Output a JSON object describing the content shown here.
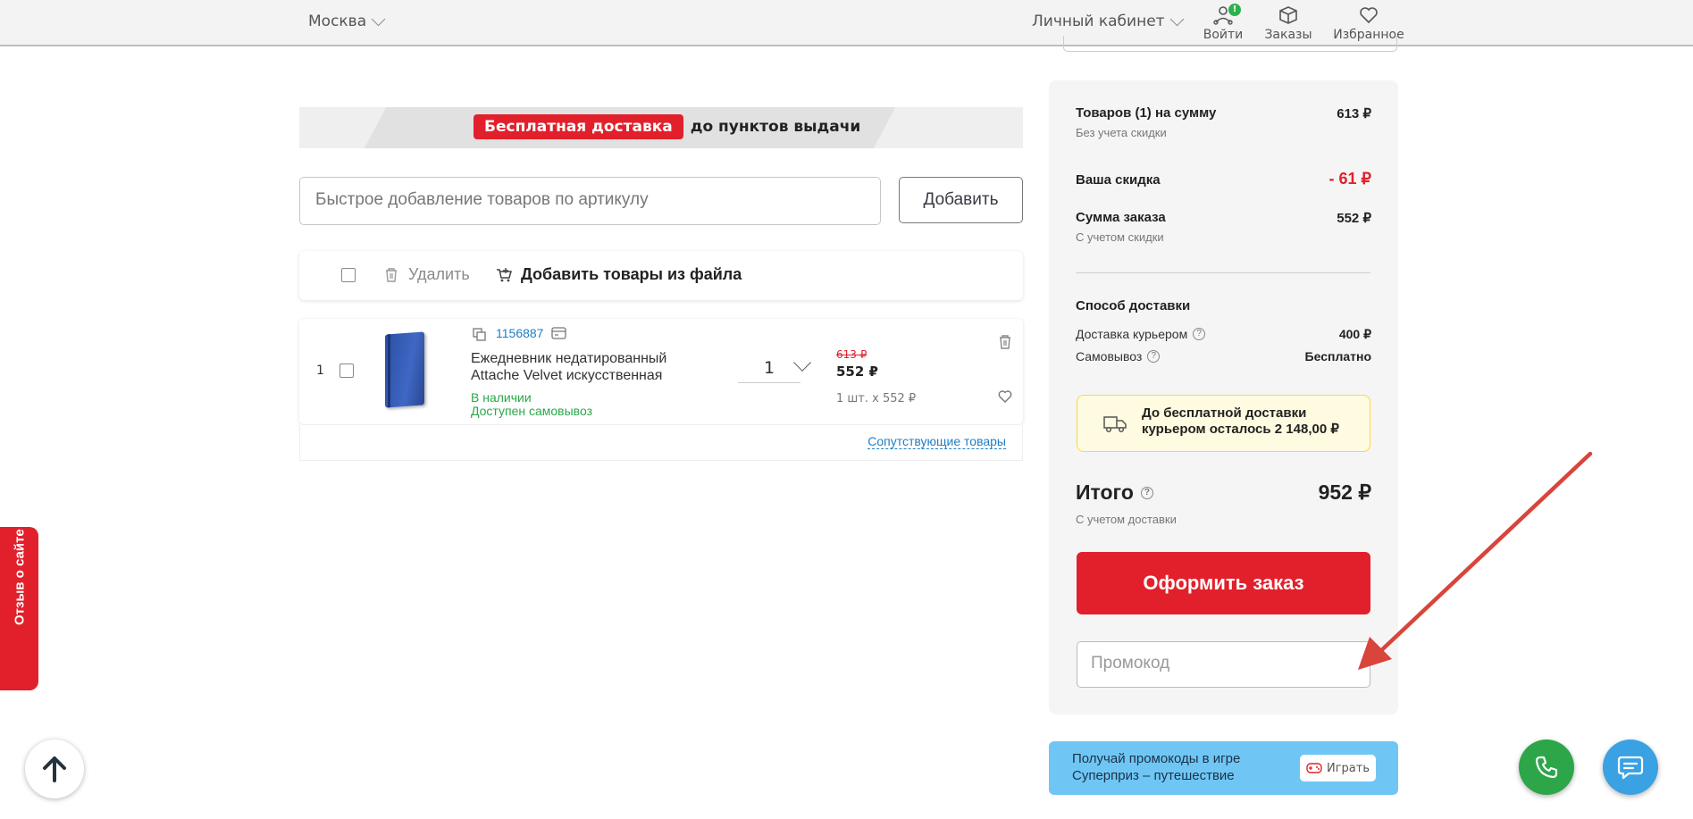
{
  "header": {
    "city": "Москва",
    "account": "Личный кабинет",
    "login": "Войти",
    "login_badge": "!",
    "orders": "Заказы",
    "favorites": "Избранное"
  },
  "banner": {
    "tag": "Бесплатная доставка",
    "text": "до пунктов выдачи"
  },
  "quick_add": {
    "placeholder": "Быстрое добавление товаров по артикулу",
    "button": "Добавить"
  },
  "toolbar": {
    "delete": "Удалить",
    "add_from_file": "Добавить товары из файла"
  },
  "cart_items": [
    {
      "index": "1",
      "sku": "1156887",
      "title": "Ежедневник недатированный Attache Velvet искусственная",
      "stock": "В наличии",
      "pickup": "Доступен самовывоз",
      "quantity": "1",
      "old_price": "613 ₽",
      "price": "552 ₽",
      "unit_price": "1 шт. х 552 ₽"
    }
  ],
  "related_link": "Сопутствующие товары",
  "summary": {
    "goods_label": "Товаров (1) на сумму",
    "goods_sub": "Без учета скидки",
    "goods_value": "613 ₽",
    "discount_label": "Ваша скидка",
    "discount_value": "- 61 ₽",
    "order_sum_label": "Сумма заказа",
    "order_sum_sub": "С учетом скидки",
    "order_sum_value": "552 ₽",
    "delivery_title": "Способ доставки",
    "courier_label": "Доставка курьером",
    "courier_value": "400 ₽",
    "pickup_label": "Самовывоз",
    "pickup_value": "Бесплатно",
    "free_delivery_note": "До бесплатной доставки курьером осталось 2 148,00 ₽",
    "total_label": "Итого",
    "total_sub": "С учетом доставки",
    "total_value": "952 ₽",
    "checkout_button": "Оформить заказ",
    "promo_placeholder": "Промокод"
  },
  "game_banner": {
    "text_line1": "Получай промокоды в игре",
    "text_line2": "Суперприз – путешествие",
    "button": "Играть"
  },
  "review_tab": "Отзыв о сайте",
  "colors": {
    "brand_red": "#e2202b",
    "link_blue": "#1f7ec4",
    "stock_green": "#2aa84a",
    "phone_green": "#2ca649",
    "chat_blue": "#3aa1e3",
    "game_blue": "#6fc6f5",
    "arrow_red": "#d9443b"
  }
}
